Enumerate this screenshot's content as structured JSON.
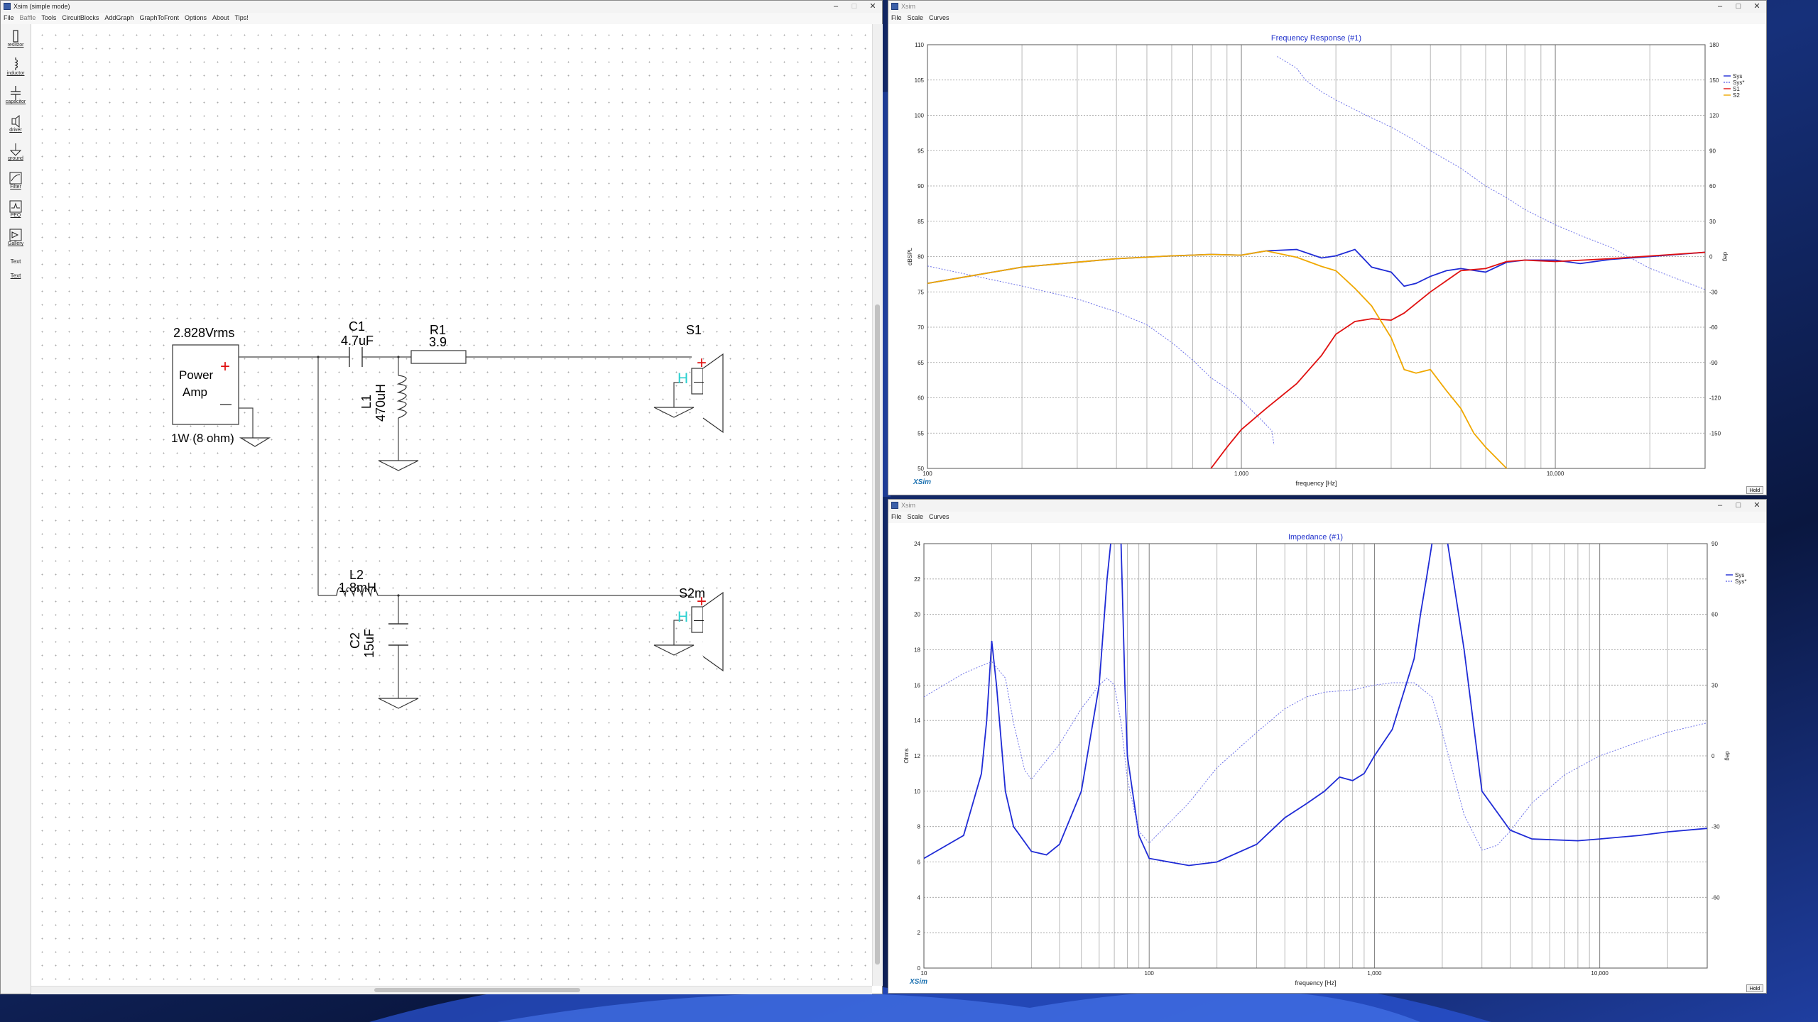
{
  "windows": {
    "xsim_main": {
      "title": "Xsim (simple mode)",
      "menu": [
        "File",
        "Baffle",
        "Tools",
        "CircuitBlocks",
        "AddGraph",
        "GraphToFront",
        "Options",
        "About",
        "Tips!"
      ],
      "controls": [
        "–",
        "□",
        "✕"
      ],
      "tools": [
        {
          "label": "resistor",
          "icon": "resistor-icon"
        },
        {
          "label": "inductor",
          "icon": "inductor-icon"
        },
        {
          "label": "capacitor",
          "icon": "capacitor-icon"
        },
        {
          "label": "driver",
          "icon": "driver-icon"
        },
        {
          "label": "ground",
          "icon": "ground-icon"
        },
        {
          "label": "Filter",
          "icon": "filter-icon"
        },
        {
          "label": "PEQ",
          "icon": "peq-icon"
        },
        {
          "label": "Gallery",
          "icon": "gallery-icon"
        },
        {
          "label": "Text",
          "icon": "text-icon"
        },
        {
          "label": "Text",
          "icon": "text-underline-icon"
        }
      ],
      "circuit": {
        "amp_voltage": "2.828Vrms",
        "amp_label_1": "Power",
        "amp_label_2": "Amp",
        "amp_power": "1W (8 ohm)",
        "c1_name": "C1",
        "c1_value": "4.7uF",
        "r1_name": "R1",
        "r1_value": "3.9",
        "l1_name": "L1",
        "l1_value": "470uH",
        "s1_name": "S1",
        "l2_name": "L2",
        "l2_value": "1.8mH",
        "c2_name": "C2",
        "c2_value": "15uF",
        "s2_name": "S2m",
        "driver_marker": "H",
        "plus": "+",
        "minus": "—"
      }
    },
    "freq_graph": {
      "window_title": "Xsim",
      "menu": [
        "File",
        "Scale",
        "Curves"
      ],
      "title": "Frequency Response (#1)",
      "xlabel": "frequency [Hz]",
      "ylabel": "dBSPL",
      "y2label": "deg",
      "logo": "XSim",
      "hold": "Hold",
      "x_ticks": [
        "100",
        "1,000",
        "10,000"
      ],
      "y_ticks": [
        "110",
        "105",
        "100",
        "95",
        "90",
        "85",
        "80",
        "75",
        "70",
        "65",
        "60",
        "55",
        "50"
      ],
      "y2_ticks": [
        "180",
        "150",
        "120",
        "90",
        "60",
        "30",
        "0",
        "-30",
        "-60",
        "-90",
        "-120",
        "-150"
      ],
      "legend": [
        {
          "name": "Sys",
          "color": "#1f2bd6",
          "dash": false
        },
        {
          "name": "Sys*",
          "color": "#6f74e8",
          "dash": true
        },
        {
          "name": "S1",
          "color": "#e01010",
          "dash": false
        },
        {
          "name": "S2",
          "color": "#f0a800",
          "dash": false
        }
      ]
    },
    "imp_graph": {
      "window_title": "Xsim",
      "menu": [
        "File",
        "Scale",
        "Curves"
      ],
      "title": "Impedance (#1)",
      "xlabel": "frequency [Hz]",
      "ylabel": "Ohms",
      "y2label": "deg",
      "logo": "XSim",
      "hold": "Hold",
      "x_ticks": [
        "10",
        "100",
        "1,000",
        "10,000"
      ],
      "y_ticks": [
        "24",
        "22",
        "20",
        "18",
        "16",
        "14",
        "12",
        "10",
        "8",
        "6",
        "4",
        "2",
        "0"
      ],
      "y2_ticks": [
        "90",
        "60",
        "30",
        "0",
        "-30",
        "-60"
      ],
      "legend": [
        {
          "name": "Sys",
          "color": "#1f2bd6",
          "dash": false
        },
        {
          "name": "Sys*",
          "color": "#6f74e8",
          "dash": true
        }
      ]
    }
  },
  "chart_data": [
    {
      "type": "line",
      "title": "Frequency Response (#1)",
      "xlabel": "frequency [Hz]",
      "ylabel": "dBSPL",
      "y2label": "deg",
      "x_scale": "log",
      "xlim": [
        100,
        30000
      ],
      "ylim": [
        50,
        110
      ],
      "y2lim": [
        -180,
        180
      ],
      "grid": true,
      "legend_position": "top-right",
      "series": [
        {
          "name": "Sys",
          "axis": "left",
          "color": "#1f2bd6",
          "x": [
            100,
            200,
            400,
            600,
            800,
            1000,
            1200,
            1500,
            1800,
            2000,
            2300,
            2600,
            3000,
            3300,
            3600,
            4000,
            4500,
            5000,
            6000,
            7000,
            8000,
            10000,
            12000,
            15000,
            20000,
            30000
          ],
          "y": [
            76.2,
            78.5,
            79.7,
            80.1,
            80.3,
            80.2,
            80.8,
            81.0,
            79.8,
            80.1,
            81.0,
            78.5,
            77.8,
            75.8,
            76.2,
            77.2,
            78.0,
            78.3,
            77.8,
            79.2,
            79.5,
            79.5,
            79.0,
            79.6,
            80.0,
            80.6
          ]
        },
        {
          "name": "Sys*",
          "axis": "right",
          "color": "#6f74e8",
          "x": [
            100,
            150,
            200,
            300,
            400,
            500,
            600,
            700,
            800,
            900,
            1000,
            1150,
            1250,
            1270,
            1300,
            1400,
            1500,
            1600,
            1800,
            2000,
            2500,
            3000,
            3500,
            4000,
            5000,
            6000,
            7000,
            8000,
            10000,
            12000,
            15000,
            20000,
            30000
          ],
          "y": [
            -8,
            -18,
            -25,
            -36,
            -47,
            -58,
            -73,
            -88,
            -103,
            -112,
            -122,
            -138,
            -148,
            -160,
            170,
            165,
            160,
            150,
            140,
            133,
            120,
            110,
            100,
            90,
            75,
            60,
            50,
            40,
            27,
            18,
            8,
            -10,
            -28
          ]
        },
        {
          "name": "S1",
          "axis": "left",
          "color": "#e01010",
          "x": [
            800,
            900,
            1000,
            1200,
            1500,
            1800,
            2000,
            2300,
            2600,
            3000,
            3300,
            4000,
            5000,
            6000,
            7000,
            8000,
            10000,
            15000,
            30000
          ],
          "y": [
            50,
            53,
            55.5,
            58.5,
            62,
            66,
            69,
            70.8,
            71.2,
            71.0,
            72,
            75,
            78,
            78.3,
            79.3,
            79.5,
            79.3,
            79.7,
            80.6
          ]
        },
        {
          "name": "S2",
          "axis": "left",
          "color": "#f0a800",
          "x": [
            100,
            200,
            400,
            600,
            800,
            1000,
            1200,
            1500,
            1800,
            2000,
            2300,
            2600,
            3000,
            3300,
            3600,
            4000,
            4500,
            5000,
            5500,
            6000,
            7000,
            8000
          ],
          "y": [
            76.2,
            78.5,
            79.7,
            80.1,
            80.3,
            80.2,
            80.8,
            79.9,
            78.6,
            78.0,
            75.5,
            73,
            68.5,
            64,
            63.5,
            64,
            61,
            58.5,
            55,
            53,
            50,
            48
          ]
        }
      ]
    },
    {
      "type": "line",
      "title": "Impedance (#1)",
      "xlabel": "frequency [Hz]",
      "ylabel": "Ohms",
      "y2label": "deg",
      "x_scale": "log",
      "xlim": [
        10,
        30000
      ],
      "ylim": [
        0,
        24
      ],
      "y2lim": [
        -90,
        90
      ],
      "grid": true,
      "legend_position": "top-right",
      "series": [
        {
          "name": "Sys",
          "axis": "left",
          "color": "#1f2bd6",
          "x": [
            10,
            15,
            18,
            19,
            20,
            21,
            23,
            25,
            30,
            35,
            40,
            50,
            60,
            65,
            70,
            73,
            75,
            78,
            80,
            90,
            100,
            150,
            200,
            300,
            400,
            500,
            600,
            700,
            800,
            900,
            1000,
            1200,
            1500,
            1600,
            1700,
            1800,
            2000,
            2500,
            3000,
            4000,
            5000,
            8000,
            10000,
            15000,
            20000,
            30000
          ],
          "y": [
            6.2,
            7.5,
            11,
            14,
            18.5,
            16,
            10,
            8,
            6.6,
            6.4,
            7,
            10,
            16,
            22,
            26,
            26,
            24,
            16,
            12,
            7.5,
            6.2,
            5.8,
            6.0,
            7.0,
            8.5,
            9.3,
            10.0,
            10.8,
            10.6,
            11.0,
            12.0,
            13.5,
            17.5,
            20,
            22,
            24,
            26,
            18,
            10,
            7.8,
            7.3,
            7.2,
            7.3,
            7.5,
            7.7,
            7.9
          ]
        },
        {
          "name": "Sys*",
          "axis": "right",
          "color": "#6f74e8",
          "x": [
            10,
            15,
            20,
            23,
            25,
            28,
            30,
            40,
            50,
            60,
            65,
            70,
            75,
            80,
            90,
            100,
            150,
            200,
            300,
            400,
            500,
            600,
            800,
            1000,
            1200,
            1500,
            1800,
            2000,
            2500,
            3000,
            3500,
            4000,
            5000,
            7000,
            10000,
            15000,
            20000,
            30000
          ],
          "y": [
            25,
            35,
            40,
            33,
            14,
            -6,
            -10,
            5,
            20,
            30,
            33,
            30,
            14,
            -10,
            -32,
            -37,
            -20,
            -5,
            10,
            20,
            25,
            27,
            28,
            30,
            31,
            31,
            25,
            10,
            -25,
            -40,
            -38,
            -32,
            -20,
            -8,
            0,
            6,
            10,
            14
          ]
        }
      ]
    }
  ]
}
